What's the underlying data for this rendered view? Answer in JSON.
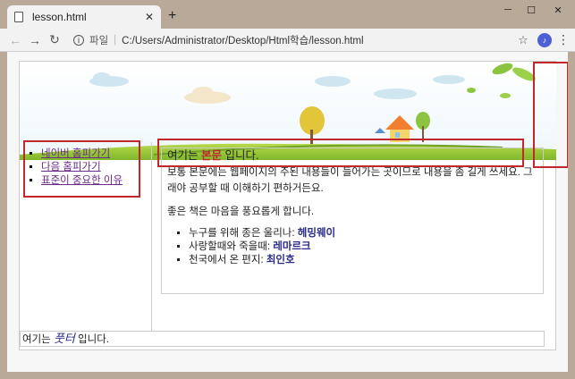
{
  "browser": {
    "tab_title": "lesson.html",
    "new_tab": "+",
    "address_scheme": "파일",
    "address_path": "C:/Users/Administrator/Desktop/Html학습/lesson.html"
  },
  "sidebar": {
    "items": [
      {
        "label": "네이버 홈피가기"
      },
      {
        "label": "다음 홈피가기"
      },
      {
        "label": "표준이 중요한 이유"
      }
    ]
  },
  "main": {
    "heading_prefix": "여기는",
    "heading_em": "본문",
    "heading_suffix": "입니다.",
    "paragraph1": "보통 본문에는 웹페이지의 주된 내용들이 들어가는 곳이므로 내용을 좀 길게 쓰세요. 그래야 공부할 때 이해하기 편하거든요.",
    "paragraph2": "좋은 책은 마음을 풍요롭게 합니다.",
    "books": [
      {
        "prefix": "누구를 위해 종은 울리나: ",
        "author": "헤밍웨이"
      },
      {
        "prefix": "사랑할때와 죽을때: ",
        "author": "레마르크"
      },
      {
        "prefix": "천국에서 온 편지: ",
        "author": "최인호"
      }
    ]
  },
  "footer": {
    "prefix": "여기는 ",
    "em": "풋터",
    "suffix": " 입니다."
  },
  "colors": {
    "accent_red": "#c0282e",
    "link_visited": "#6a2b8a",
    "author_blue": "#2a2a8a"
  }
}
